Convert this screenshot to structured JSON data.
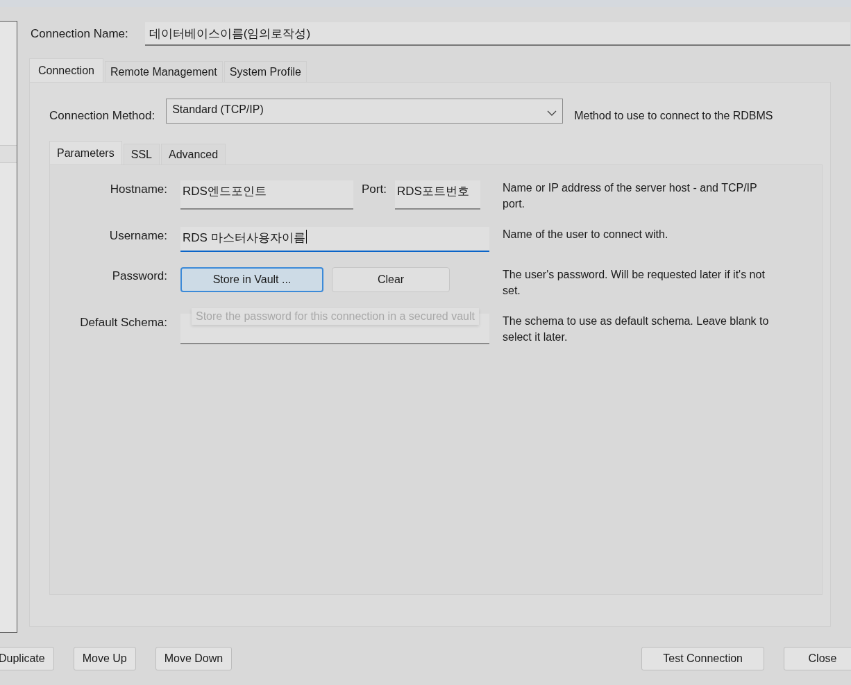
{
  "connection_name": {
    "label": "Connection Name:",
    "value": "데이터베이스이름(임의로작성)"
  },
  "tabs": [
    {
      "label": "Connection",
      "selected": true
    },
    {
      "label": "Remote Management",
      "selected": false
    },
    {
      "label": "System Profile",
      "selected": false
    }
  ],
  "connection_method": {
    "label": "Connection Method:",
    "value": "Standard (TCP/IP)",
    "description": "Method to use to connect to the RDBMS"
  },
  "subtabs": [
    {
      "label": "Parameters",
      "selected": true
    },
    {
      "label": "SSL",
      "selected": false
    },
    {
      "label": "Advanced",
      "selected": false
    }
  ],
  "parameters": [
    {
      "kind": "host",
      "label": "Hostname:",
      "value": "RDS엔드포인트",
      "port_label": "Port:",
      "port_value": "RDS포트번호",
      "description": "Name or IP address of the server host - and TCP/IP port."
    },
    {
      "kind": "field",
      "label": "Username:",
      "value": "RDS 마스터사용자이름",
      "focused": true,
      "description": "Name of the user to connect with."
    },
    {
      "kind": "buttons",
      "label": "Password:",
      "buttons": [
        {
          "label": "Store in Vault ...",
          "focused": true
        },
        {
          "label": "Clear",
          "focused": false
        }
      ],
      "description": "The user's password. Will be requested later if it's not set."
    },
    {
      "kind": "field",
      "label": "Default Schema:",
      "focused": false,
      "description": "The schema to use as default schema. Leave blank to select it later."
    }
  ],
  "tooltip": "Store the password for this connection in a secured vault",
  "left_buttons": [
    "Duplicate",
    "Move Up",
    "Move Down"
  ],
  "right_buttons": [
    "Test Connection",
    "Close"
  ]
}
